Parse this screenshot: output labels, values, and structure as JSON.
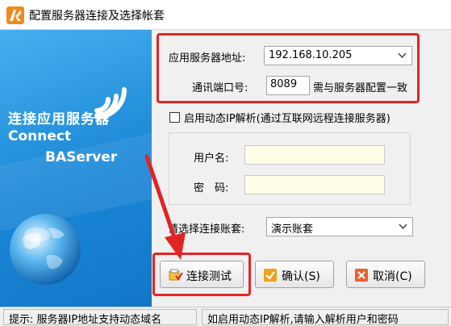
{
  "window": {
    "title": "配置服务器连接及选择帐套"
  },
  "brand": {
    "cn": "连接应用服务器",
    "en_line1": "Connect",
    "en_line2": "BAServer"
  },
  "form": {
    "server_label": "应用服务器地址:",
    "server_value": "192.168.10.205",
    "port_label": "通讯端口号:",
    "port_value": "8089",
    "port_hint": "需与服务器配置一致",
    "dynamic_ip_label": "启用动态IP解析(通过互联网远程连接服务器)",
    "dynamic_ip_checked": false,
    "username_label": "用户名:",
    "username_value": "",
    "password_label": "密　码:",
    "password_value": "",
    "account_label": "请选择连接账套:",
    "account_value": "演示账套"
  },
  "buttons": {
    "test": "连接测试",
    "ok": "确认(S)",
    "cancel": "取消(C)"
  },
  "status": {
    "left": "提示: 服务器IP地址支持动态域名",
    "right": "如启用动态IP解析,请输入解析用户和密码"
  },
  "colors": {
    "highlight": "#e22424",
    "panel_blue": "#1a86d6"
  }
}
